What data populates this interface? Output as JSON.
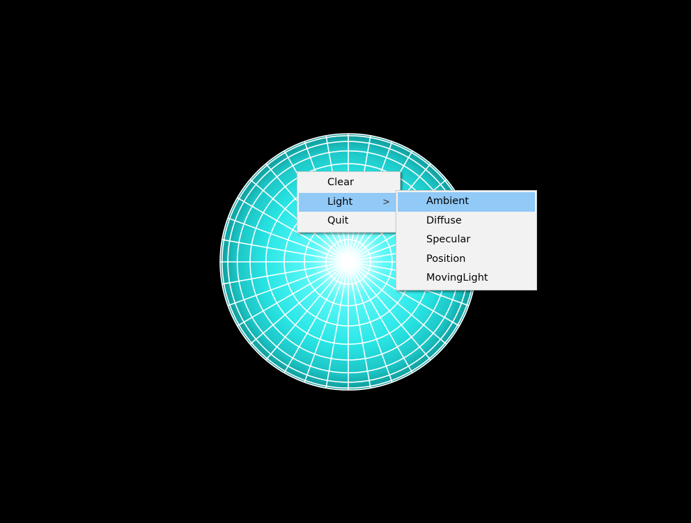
{
  "viewport": {
    "background": "#000000",
    "object": "lit-sphere"
  },
  "sphere": {
    "color_center": "#ffffff",
    "color_mid": "#2ef0f0",
    "color_edge": "#0fa6a6",
    "wire_color": "#ffffff"
  },
  "context_menu": {
    "items": [
      {
        "label": "Clear"
      },
      {
        "label": "Light",
        "has_submenu": true,
        "arrow": ">"
      },
      {
        "label": "Quit"
      }
    ],
    "highlighted": "Light"
  },
  "light_submenu": {
    "items": [
      {
        "label": "Ambient"
      },
      {
        "label": "Diffuse"
      },
      {
        "label": "Specular"
      },
      {
        "label": "Position"
      },
      {
        "label": "MovingLight"
      }
    ],
    "highlighted": "Ambient",
    "highlight_color": "#91c9f7"
  }
}
